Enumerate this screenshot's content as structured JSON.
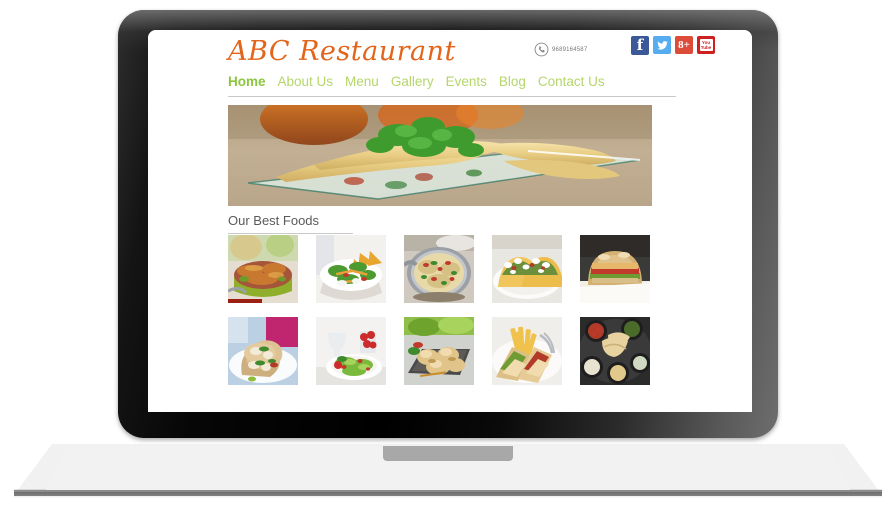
{
  "device": {
    "type": "laptop-mockup",
    "bezel_color": "#000000",
    "base_color": "#f1f1f1",
    "base_edge_color": "#8c8c8c",
    "trackpad_notch_color": "#a8a8a8"
  },
  "site": {
    "logo": "ABC Restaurant",
    "logo_color": "#e2651a",
    "contact": {
      "phone_icon": "phone-circle-icon",
      "phone_number": "9689164587"
    },
    "socials": [
      {
        "name": "facebook",
        "label": "f",
        "color": "#3b5998"
      },
      {
        "name": "twitter",
        "label": "",
        "color": "#55acee"
      },
      {
        "name": "googleplus",
        "label": "8+",
        "color": "#dd4b39"
      },
      {
        "name": "youtube",
        "label": "You Tube",
        "color": "#cd201f"
      }
    ],
    "nav": {
      "active_color": "#8cc63e",
      "idle_color": "#b5d66a",
      "items": [
        {
          "label": "Home",
          "active": true
        },
        {
          "label": "About Us",
          "active": false
        },
        {
          "label": "Menu",
          "active": false
        },
        {
          "label": "Gallery",
          "active": false
        },
        {
          "label": "Events",
          "active": false
        },
        {
          "label": "Blog",
          "active": false
        },
        {
          "label": "Contact Us",
          "active": false
        }
      ]
    },
    "hero": {
      "alt": "Crepes rolled on a glass plate garnished with cilantro on a wooden table"
    },
    "section": {
      "title": "Our Best Foods"
    },
    "gallery": {
      "rows": [
        [
          {
            "alt": "Stir-fried noodles in a green bowl"
          },
          {
            "alt": "Garden salad with tortilla chips in a white bowl"
          },
          {
            "alt": "Rice and vegetable skillet in a steel pan"
          },
          {
            "alt": "Two soft tacos with feta on a white plate"
          },
          {
            "alt": "Layered sandwich on a napkin"
          }
        ],
        [
          {
            "alt": "Chicken wrap halves on a white plate"
          },
          {
            "alt": "Salad plate with wine glass and cherry tomatoes"
          },
          {
            "alt": "Baked stuffed potatoes on a slate board"
          },
          {
            "alt": "Club sandwich with french fries"
          },
          {
            "alt": "Platter of flatbread with assorted dips"
          }
        ]
      ]
    }
  }
}
